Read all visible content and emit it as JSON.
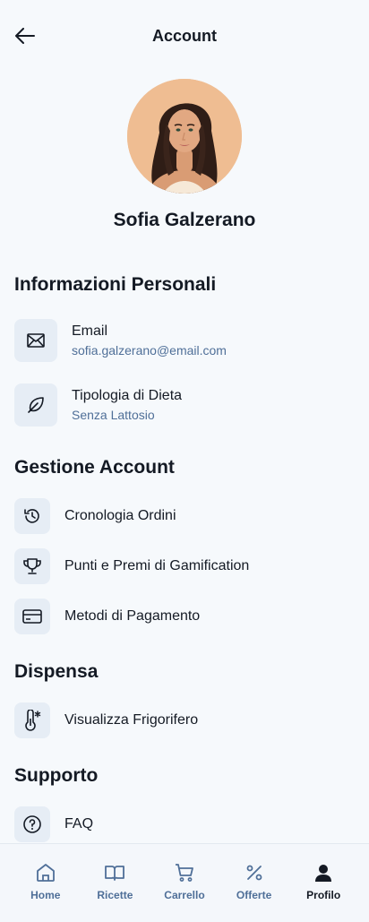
{
  "header": {
    "title": "Account"
  },
  "profile": {
    "name": "Sofia Galzerano"
  },
  "colors": {
    "accent": "#4f6f98",
    "icon_bg": "#e6edf5",
    "background": "#f6f9fc",
    "text": "#141a24"
  },
  "sections": {
    "personal": {
      "title": "Informazioni Personali",
      "email": {
        "label": "Email",
        "value": "sofia.galzerano@email.com",
        "icon": "envelope-icon"
      },
      "diet": {
        "label": "Tipologia di Dieta",
        "value": "Senza Lattosio",
        "icon": "leaf-icon"
      }
    },
    "account": {
      "title": "Gestione Account",
      "items": [
        {
          "label": "Cronologia Ordini",
          "icon": "history-icon"
        },
        {
          "label": "Punti e Premi di Gamification",
          "icon": "trophy-icon"
        },
        {
          "label": "Metodi di Pagamento",
          "icon": "credit-card-icon"
        }
      ]
    },
    "pantry": {
      "title": "Dispensa",
      "items": [
        {
          "label": "Visualizza Frigorifero",
          "icon": "thermometer-icon"
        }
      ]
    },
    "support": {
      "title": "Supporto",
      "items": [
        {
          "label": "FAQ",
          "icon": "help-circle-icon"
        }
      ]
    }
  },
  "nav": {
    "items": [
      {
        "label": "Home",
        "icon": "home-icon"
      },
      {
        "label": "Ricette",
        "icon": "book-icon"
      },
      {
        "label": "Carrello",
        "icon": "cart-icon"
      },
      {
        "label": "Offerte",
        "icon": "percent-icon"
      },
      {
        "label": "Profilo",
        "icon": "user-icon",
        "active": true
      }
    ]
  }
}
